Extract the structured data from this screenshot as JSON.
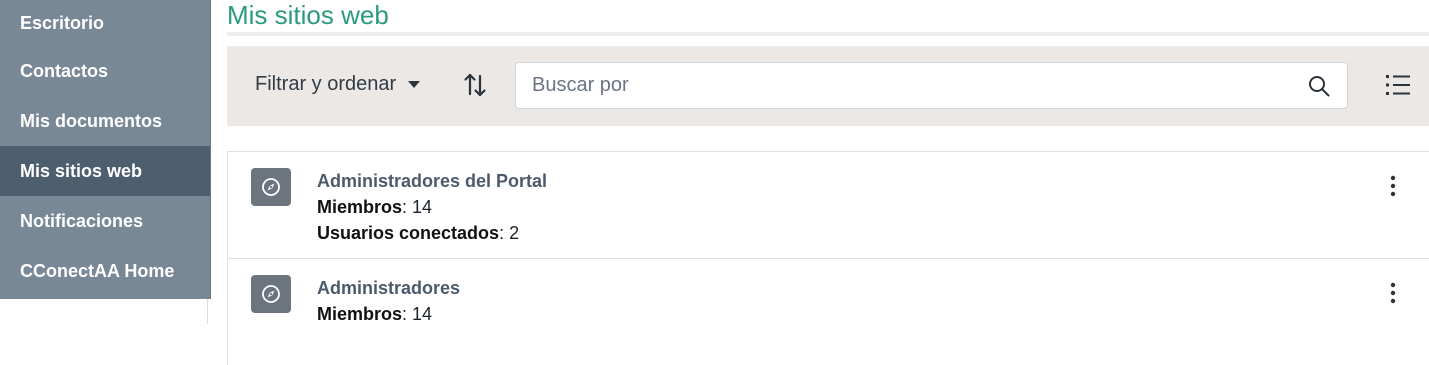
{
  "sidebar": {
    "items": [
      {
        "label": "Escritorio"
      },
      {
        "label": "Contactos"
      },
      {
        "label": "Mis documentos"
      },
      {
        "label": "Mis sitios web"
      },
      {
        "label": "Notificaciones"
      },
      {
        "label": "CConectAA Home"
      }
    ],
    "active_item": "Mis sitios web"
  },
  "page": {
    "title": "Mis sitios web"
  },
  "toolbar": {
    "filter_label": "Filtrar y ordenar",
    "sort_icon": "sort-icon",
    "search_placeholder": "Buscar por",
    "search_value": "",
    "view_icon": "list-view-icon"
  },
  "sites": [
    {
      "name": "Administradores del Portal",
      "members_label": "Miembros",
      "members": "14",
      "connected_label": "Usuarios conectados",
      "connected": "2"
    },
    {
      "name": "Administradores",
      "members_label": "Miembros",
      "members": "14"
    }
  ],
  "colors": {
    "sidebar_bg": "#798896",
    "sidebar_active": "#4d5f6f",
    "title_green": "#2b9b7e",
    "toolbar_bg": "#ebe8e6",
    "site_icon_bg": "#6c757e"
  }
}
